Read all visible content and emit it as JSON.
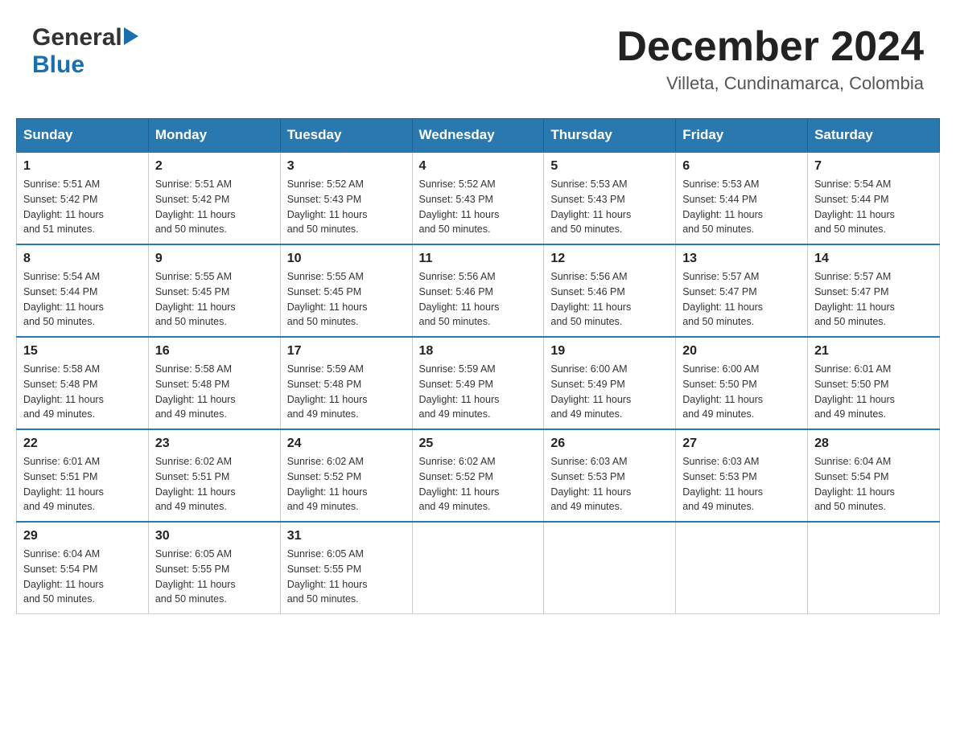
{
  "header": {
    "logo": {
      "general": "General",
      "blue": "Blue"
    },
    "title": "December 2024",
    "location": "Villeta, Cundinamarca, Colombia"
  },
  "weekdays": [
    "Sunday",
    "Monday",
    "Tuesday",
    "Wednesday",
    "Thursday",
    "Friday",
    "Saturday"
  ],
  "weeks": [
    [
      {
        "day": 1,
        "sunrise": "5:51 AM",
        "sunset": "5:42 PM",
        "daylight": "11 hours and 51 minutes."
      },
      {
        "day": 2,
        "sunrise": "5:51 AM",
        "sunset": "5:42 PM",
        "daylight": "11 hours and 50 minutes."
      },
      {
        "day": 3,
        "sunrise": "5:52 AM",
        "sunset": "5:43 PM",
        "daylight": "11 hours and 50 minutes."
      },
      {
        "day": 4,
        "sunrise": "5:52 AM",
        "sunset": "5:43 PM",
        "daylight": "11 hours and 50 minutes."
      },
      {
        "day": 5,
        "sunrise": "5:53 AM",
        "sunset": "5:43 PM",
        "daylight": "11 hours and 50 minutes."
      },
      {
        "day": 6,
        "sunrise": "5:53 AM",
        "sunset": "5:44 PM",
        "daylight": "11 hours and 50 minutes."
      },
      {
        "day": 7,
        "sunrise": "5:54 AM",
        "sunset": "5:44 PM",
        "daylight": "11 hours and 50 minutes."
      }
    ],
    [
      {
        "day": 8,
        "sunrise": "5:54 AM",
        "sunset": "5:44 PM",
        "daylight": "11 hours and 50 minutes."
      },
      {
        "day": 9,
        "sunrise": "5:55 AM",
        "sunset": "5:45 PM",
        "daylight": "11 hours and 50 minutes."
      },
      {
        "day": 10,
        "sunrise": "5:55 AM",
        "sunset": "5:45 PM",
        "daylight": "11 hours and 50 minutes."
      },
      {
        "day": 11,
        "sunrise": "5:56 AM",
        "sunset": "5:46 PM",
        "daylight": "11 hours and 50 minutes."
      },
      {
        "day": 12,
        "sunrise": "5:56 AM",
        "sunset": "5:46 PM",
        "daylight": "11 hours and 50 minutes."
      },
      {
        "day": 13,
        "sunrise": "5:57 AM",
        "sunset": "5:47 PM",
        "daylight": "11 hours and 50 minutes."
      },
      {
        "day": 14,
        "sunrise": "5:57 AM",
        "sunset": "5:47 PM",
        "daylight": "11 hours and 50 minutes."
      }
    ],
    [
      {
        "day": 15,
        "sunrise": "5:58 AM",
        "sunset": "5:48 PM",
        "daylight": "11 hours and 49 minutes."
      },
      {
        "day": 16,
        "sunrise": "5:58 AM",
        "sunset": "5:48 PM",
        "daylight": "11 hours and 49 minutes."
      },
      {
        "day": 17,
        "sunrise": "5:59 AM",
        "sunset": "5:48 PM",
        "daylight": "11 hours and 49 minutes."
      },
      {
        "day": 18,
        "sunrise": "5:59 AM",
        "sunset": "5:49 PM",
        "daylight": "11 hours and 49 minutes."
      },
      {
        "day": 19,
        "sunrise": "6:00 AM",
        "sunset": "5:49 PM",
        "daylight": "11 hours and 49 minutes."
      },
      {
        "day": 20,
        "sunrise": "6:00 AM",
        "sunset": "5:50 PM",
        "daylight": "11 hours and 49 minutes."
      },
      {
        "day": 21,
        "sunrise": "6:01 AM",
        "sunset": "5:50 PM",
        "daylight": "11 hours and 49 minutes."
      }
    ],
    [
      {
        "day": 22,
        "sunrise": "6:01 AM",
        "sunset": "5:51 PM",
        "daylight": "11 hours and 49 minutes."
      },
      {
        "day": 23,
        "sunrise": "6:02 AM",
        "sunset": "5:51 PM",
        "daylight": "11 hours and 49 minutes."
      },
      {
        "day": 24,
        "sunrise": "6:02 AM",
        "sunset": "5:52 PM",
        "daylight": "11 hours and 49 minutes."
      },
      {
        "day": 25,
        "sunrise": "6:02 AM",
        "sunset": "5:52 PM",
        "daylight": "11 hours and 49 minutes."
      },
      {
        "day": 26,
        "sunrise": "6:03 AM",
        "sunset": "5:53 PM",
        "daylight": "11 hours and 49 minutes."
      },
      {
        "day": 27,
        "sunrise": "6:03 AM",
        "sunset": "5:53 PM",
        "daylight": "11 hours and 49 minutes."
      },
      {
        "day": 28,
        "sunrise": "6:04 AM",
        "sunset": "5:54 PM",
        "daylight": "11 hours and 50 minutes."
      }
    ],
    [
      {
        "day": 29,
        "sunrise": "6:04 AM",
        "sunset": "5:54 PM",
        "daylight": "11 hours and 50 minutes."
      },
      {
        "day": 30,
        "sunrise": "6:05 AM",
        "sunset": "5:55 PM",
        "daylight": "11 hours and 50 minutes."
      },
      {
        "day": 31,
        "sunrise": "6:05 AM",
        "sunset": "5:55 PM",
        "daylight": "11 hours and 50 minutes."
      },
      null,
      null,
      null,
      null
    ]
  ],
  "labels": {
    "sunrise": "Sunrise:",
    "sunset": "Sunset:",
    "daylight": "Daylight:"
  }
}
